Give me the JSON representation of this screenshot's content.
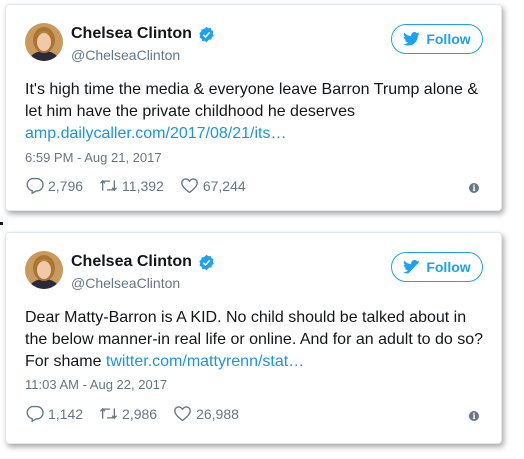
{
  "tweets": [
    {
      "name": "Chelsea Clinton",
      "handle": "@ChelseaClinton",
      "follow_label": "Follow",
      "text": "It's high time the media & everyone leave Barron Trump alone & let him have the private childhood he deserves ",
      "link": "amp.dailycaller.com/2017/08/21/its…",
      "timestamp": "6:59 PM - Aug 21, 2017",
      "replies": "2,796",
      "retweets": "11,392",
      "likes": "67,244"
    },
    {
      "name": "Chelsea Clinton",
      "handle": "@ChelseaClinton",
      "follow_label": "Follow",
      "text": "Dear Matty-Barron is A KID. No child should be talked about in the below manner-in real life or online. And for an adult to do so? For shame ",
      "link": "twitter.com/mattyrenn/stat…",
      "timestamp": "11:03 AM - Aug 22, 2017",
      "replies": "1,142",
      "retweets": "2,986",
      "likes": "26,988"
    }
  ],
  "colors": {
    "accent": "#1da1f2",
    "link": "#1b95e0",
    "secondary_text": "#657786",
    "primary_text": "#14171a"
  },
  "icons": [
    "verified-badge-icon",
    "twitter-bird-icon",
    "reply-icon",
    "retweet-icon",
    "like-icon",
    "info-icon"
  ]
}
